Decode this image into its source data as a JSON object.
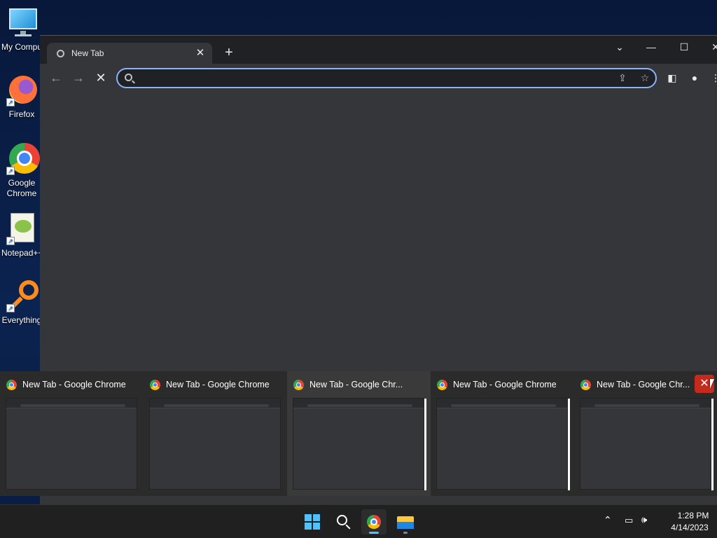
{
  "desktop": {
    "icons": [
      {
        "label": "My Computer"
      },
      {
        "label": "Firefox"
      },
      {
        "label": "Google Chrome"
      },
      {
        "label": "Notepad++"
      },
      {
        "label": "Everything"
      }
    ]
  },
  "browser": {
    "tab_title": "New Tab",
    "omnibox_value": "",
    "colors": {
      "frame": "#202124",
      "toolbar": "#35363a",
      "omnibox_border": "#8ab4f8"
    }
  },
  "task_switcher": {
    "items": [
      {
        "title": "New Tab - Google Chrome"
      },
      {
        "title": "New Tab - Google Chrome"
      },
      {
        "title": "New Tab - Google Chr..."
      },
      {
        "title": "New Tab - Google Chrome"
      },
      {
        "title": "New Tab - Google Chr..."
      }
    ],
    "close_color": "#c42b1c"
  },
  "taskbar": {
    "time": "1:28 PM",
    "date": "4/14/2023"
  }
}
